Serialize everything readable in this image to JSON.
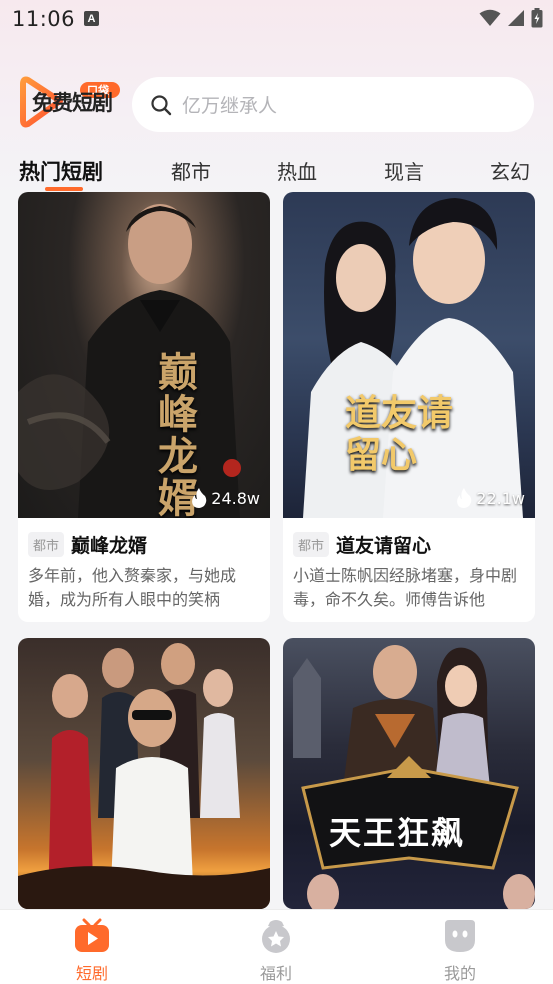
{
  "status_bar": {
    "time": "11:06",
    "notification_icon": "A"
  },
  "header": {
    "logo": {
      "main": "免费短剧",
      "badge": "口袋"
    },
    "search_placeholder": "亿万继承人"
  },
  "tabs": [
    {
      "label": "热门短剧",
      "active": true
    },
    {
      "label": "都市",
      "active": false
    },
    {
      "label": "热血",
      "active": false
    },
    {
      "label": "现言",
      "active": false
    },
    {
      "label": "玄幻",
      "active": false
    }
  ],
  "cards": [
    {
      "tag": "都市",
      "title": "巅峰龙婿",
      "description": "多年前，他入赘秦家，与她成婚，成为所有人眼中的笑柄",
      "views": "24.8w",
      "poster_text": "巅峰龙婿"
    },
    {
      "tag": "都市",
      "title": "道友请留心",
      "description": "小道士陈帆因经脉堵塞，身中剧毒，命不久矣。师傅告诉他",
      "views": "22.1w",
      "poster_text": "道友请留心"
    },
    {
      "poster_text": ""
    },
    {
      "poster_text": "天王狂飙"
    }
  ],
  "bottom_nav": [
    {
      "label": "短剧",
      "icon": "play-tv-icon",
      "active": true
    },
    {
      "label": "福利",
      "icon": "star-badge-icon",
      "active": false
    },
    {
      "label": "我的",
      "icon": "profile-icon",
      "active": false
    }
  ],
  "colors": {
    "accent": "#ff6a2b",
    "background": "#f4f4f6"
  }
}
